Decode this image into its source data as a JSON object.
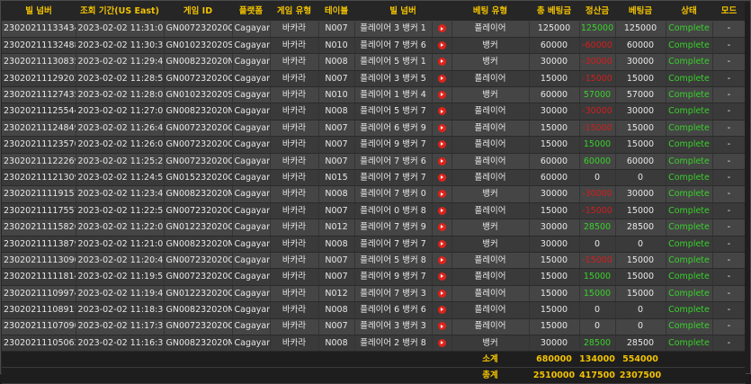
{
  "headers": {
    "bet_no": "빌 넘버",
    "time": "조회 기간(US East)",
    "game_id": "게임 ID",
    "platform": "플랫폼",
    "game_type": "게임 유형",
    "table": "테이블",
    "bill_no": "빌 넘버",
    "bet_type": "베팅 유형",
    "total_bet": "총 베팅금",
    "settle": "정산금",
    "bet_amount": "베팅금",
    "status": "상태",
    "mode": "모드"
  },
  "rows": [
    {
      "bet_no": "230202111334345",
      "time": "2023-02-02 11:31:05",
      "game_id": "GN007232020OR",
      "platform": "Cagayan",
      "game_type": "바카라",
      "table": "N007",
      "bill_no": "플레이어 3 뱅커 1",
      "bet_type": "플레이어",
      "total_bet": "125000",
      "settle": "125000",
      "settle_kind": "pos",
      "bet_amount": "125000",
      "status": "Complete",
      "mode": "-"
    },
    {
      "bet_no": "230202111324884",
      "time": "2023-02-02 11:30:37",
      "game_id": "GN010232020SZ",
      "platform": "Cagayan",
      "game_type": "바카라",
      "table": "N010",
      "bill_no": "플레이어 7 뱅커 6",
      "bet_type": "뱅커",
      "total_bet": "60000",
      "settle": "-60000",
      "settle_kind": "neg",
      "bet_amount": "60000",
      "status": "Complete",
      "mode": "-"
    },
    {
      "bet_no": "230202111308352",
      "time": "2023-02-02 11:29:47",
      "game_id": "GN008232020N4",
      "platform": "Cagayan",
      "game_type": "바카라",
      "table": "N008",
      "bill_no": "플레이어 5 뱅커 1",
      "bet_type": "뱅커",
      "total_bet": "30000",
      "settle": "-30000",
      "settle_kind": "neg",
      "bet_amount": "30000",
      "status": "Complete",
      "mode": "-"
    },
    {
      "bet_no": "230202111292036",
      "time": "2023-02-02 11:28:56",
      "game_id": "GN007232020OO",
      "platform": "Cagayan",
      "game_type": "바카라",
      "table": "N007",
      "bill_no": "플레이어 3 뱅커 5",
      "bet_type": "플레이어",
      "total_bet": "15000",
      "settle": "-15000",
      "settle_kind": "neg",
      "bet_amount": "15000",
      "status": "Complete",
      "mode": "-"
    },
    {
      "bet_no": "230202111274358",
      "time": "2023-02-02 11:28:04",
      "game_id": "GN010232020SV",
      "platform": "Cagayan",
      "game_type": "바카라",
      "table": "N010",
      "bill_no": "플레이어 1 뱅커 4",
      "bet_type": "뱅커",
      "total_bet": "60000",
      "settle": "57000",
      "settle_kind": "pos",
      "bet_amount": "57000",
      "status": "Complete",
      "mode": "-"
    },
    {
      "bet_no": "230202111255447",
      "time": "2023-02-02 11:27:08",
      "game_id": "GN008232020N0",
      "platform": "Cagayan",
      "game_type": "바카라",
      "table": "N008",
      "bill_no": "플레이어 5 뱅커 7",
      "bet_type": "플레이어",
      "total_bet": "30000",
      "settle": "-30000",
      "settle_kind": "neg",
      "bet_amount": "30000",
      "status": "Complete",
      "mode": "-"
    },
    {
      "bet_no": "230202111248490",
      "time": "2023-02-02 11:26:43",
      "game_id": "GN007232020OL",
      "platform": "Cagayan",
      "game_type": "바카라",
      "table": "N007",
      "bill_no": "플레이어 6 뱅커 9",
      "bet_type": "플레이어",
      "total_bet": "15000",
      "settle": "-15000",
      "settle_kind": "neg",
      "bet_amount": "15000",
      "status": "Complete",
      "mode": "-"
    },
    {
      "bet_no": "230202111235708",
      "time": "2023-02-02 11:26:04",
      "game_id": "GN007232020OK",
      "platform": "Cagayan",
      "game_type": "바카라",
      "table": "N007",
      "bill_no": "플레이어 9 뱅커 7",
      "bet_type": "플레이어",
      "total_bet": "15000",
      "settle": "15000",
      "settle_kind": "pos",
      "bet_amount": "15000",
      "status": "Complete",
      "mode": "-"
    },
    {
      "bet_no": "230202111222691",
      "time": "2023-02-02 11:25:20",
      "game_id": "GN007232020OJ",
      "platform": "Cagayan",
      "game_type": "바카라",
      "table": "N007",
      "bill_no": "플레이어 7 뱅커 6",
      "bet_type": "플레이어",
      "total_bet": "60000",
      "settle": "60000",
      "settle_kind": "pos",
      "bet_amount": "60000",
      "status": "Complete",
      "mode": "-"
    },
    {
      "bet_no": "230202111213097",
      "time": "2023-02-02 11:24:51",
      "game_id": "GN015232020OI",
      "platform": "Cagayan",
      "game_type": "바카라",
      "table": "N015",
      "bill_no": "플레이어 7 뱅커 7",
      "bet_type": "플레이어",
      "total_bet": "60000",
      "settle": "0",
      "settle_kind": "zero",
      "bet_amount": "0",
      "status": "Complete",
      "mode": "-"
    },
    {
      "bet_no": "230202111191512",
      "time": "2023-02-02 11:23:48",
      "game_id": "GN008232020MV",
      "platform": "Cagayan",
      "game_type": "바카라",
      "table": "N008",
      "bill_no": "플레이어 7 뱅커 0",
      "bet_type": "뱅커",
      "total_bet": "30000",
      "settle": "-30000",
      "settle_kind": "neg",
      "bet_amount": "30000",
      "status": "Complete",
      "mode": "-"
    },
    {
      "bet_no": "230202111175575",
      "time": "2023-02-02 11:22:58",
      "game_id": "GN007232020OG",
      "platform": "Cagayan",
      "game_type": "바카라",
      "table": "N007",
      "bill_no": "플레이어 0 뱅커 8",
      "bet_type": "플레이어",
      "total_bet": "15000",
      "settle": "-15000",
      "settle_kind": "neg",
      "bet_amount": "15000",
      "status": "Complete",
      "mode": "-"
    },
    {
      "bet_no": "230202111158267",
      "time": "2023-02-02 11:22:05",
      "game_id": "GN012232020QJ",
      "platform": "Cagayan",
      "game_type": "바카라",
      "table": "N012",
      "bill_no": "플레이어 7 뱅커 9",
      "bet_type": "뱅커",
      "total_bet": "30000",
      "settle": "28500",
      "settle_kind": "pos",
      "bet_amount": "28500",
      "status": "Complete",
      "mode": "-"
    },
    {
      "bet_no": "230202111138797",
      "time": "2023-02-02 11:21:08",
      "game_id": "GN008232020MR",
      "platform": "Cagayan",
      "game_type": "바카라",
      "table": "N008",
      "bill_no": "플레이어 7 뱅커 7",
      "bet_type": "뱅커",
      "total_bet": "30000",
      "settle": "0",
      "settle_kind": "zero",
      "bet_amount": "0",
      "status": "Complete",
      "mode": "-"
    },
    {
      "bet_no": "230202111130907",
      "time": "2023-02-02 11:20:42",
      "game_id": "GN007232020OD",
      "platform": "Cagayan",
      "game_type": "바카라",
      "table": "N007",
      "bill_no": "플레이어 5 뱅커 8",
      "bet_type": "플레이어",
      "total_bet": "15000",
      "settle": "-15000",
      "settle_kind": "neg",
      "bet_amount": "15000",
      "status": "Complete",
      "mode": "-"
    },
    {
      "bet_no": "230202111118145",
      "time": "2023-02-02 11:19:58",
      "game_id": "GN007232020OC",
      "platform": "Cagayan",
      "game_type": "바카라",
      "table": "N007",
      "bill_no": "플레이어 9 뱅커 7",
      "bet_type": "플레이어",
      "total_bet": "15000",
      "settle": "15000",
      "settle_kind": "pos",
      "bet_amount": "15000",
      "status": "Complete",
      "mode": "-"
    },
    {
      "bet_no": "230202111099746",
      "time": "2023-02-02 11:19:47",
      "game_id": "GN012232020QE",
      "platform": "Cagayan",
      "game_type": "바카라",
      "table": "N012",
      "bill_no": "플레이어 7 뱅커 3",
      "bet_type": "플레이어",
      "total_bet": "15000",
      "settle": "15000",
      "settle_kind": "pos",
      "bet_amount": "15000",
      "status": "Complete",
      "mode": "-"
    },
    {
      "bet_no": "230202111089111",
      "time": "2023-02-02 11:18:34",
      "game_id": "GN008232020MN",
      "platform": "Cagayan",
      "game_type": "바카라",
      "table": "N008",
      "bill_no": "플레이어 6 뱅커 6",
      "bet_type": "플레이어",
      "total_bet": "15000",
      "settle": "0",
      "settle_kind": "zero",
      "bet_amount": "0",
      "status": "Complete",
      "mode": "-"
    },
    {
      "bet_no": "230202111070905",
      "time": "2023-02-02 11:17:35",
      "game_id": "GN007232020O9",
      "platform": "Cagayan",
      "game_type": "바카라",
      "table": "N007",
      "bill_no": "플레이어 3 뱅커 3",
      "bet_type": "플레이어",
      "total_bet": "15000",
      "settle": "0",
      "settle_kind": "zero",
      "bet_amount": "0",
      "status": "Complete",
      "mode": "-"
    },
    {
      "bet_no": "230202111050628",
      "time": "2023-02-02 11:16:35",
      "game_id": "GN008232020MK",
      "platform": "Cagayan",
      "game_type": "바카라",
      "table": "N008",
      "bill_no": "플레이어 2 뱅커 8",
      "bet_type": "뱅커",
      "total_bet": "30000",
      "settle": "28500",
      "settle_kind": "pos",
      "bet_amount": "28500",
      "status": "Complete",
      "mode": "-"
    }
  ],
  "subtotal": {
    "label": "소계",
    "total_bet": "680000",
    "settle": "134000",
    "bet_amount": "554000"
  },
  "total": {
    "label": "총계",
    "total_bet": "2510000",
    "settle": "417500",
    "bet_amount": "2307500"
  },
  "icons": {
    "play": "play-video-icon"
  },
  "colors": {
    "header_text": "#f2c200",
    "positive": "#39d12b",
    "negative": "#d21e1e",
    "status": "#39d12b"
  }
}
